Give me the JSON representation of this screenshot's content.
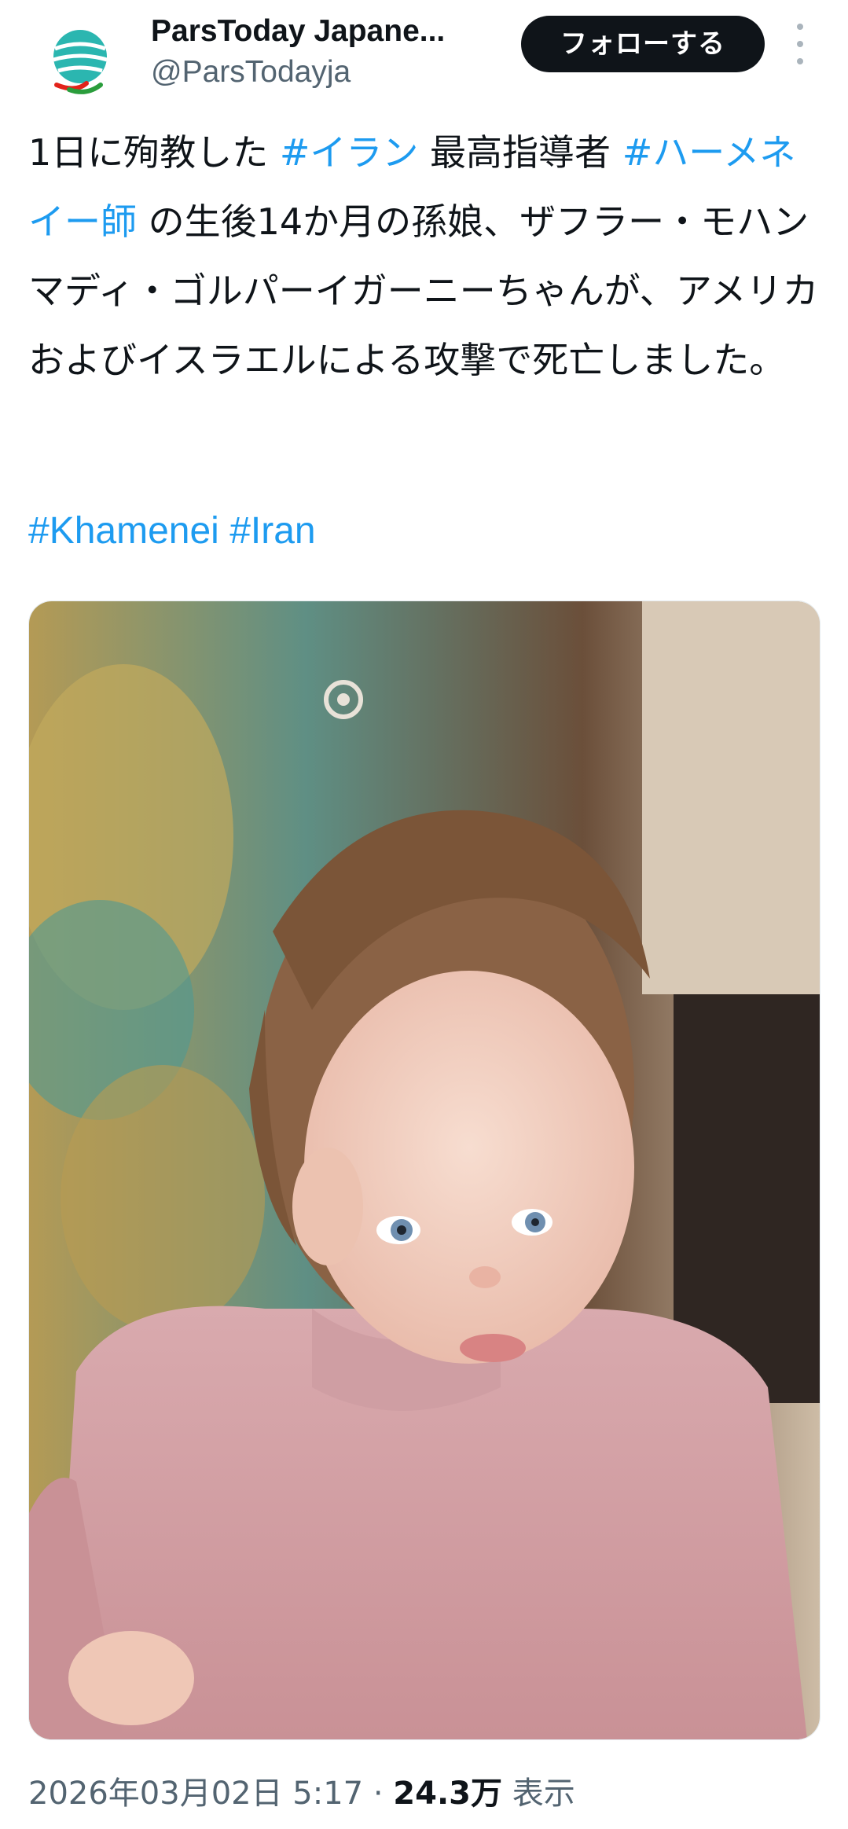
{
  "account": {
    "display_name": "ParsToday Japane...",
    "handle": "@ParsTodayja",
    "avatar_icon": "parstoday-logo-icon"
  },
  "follow_button": {
    "label": "フォローする"
  },
  "more_icon": "more-vertical-icon",
  "tweet": {
    "segments": [
      {
        "text": "1日に殉教した ",
        "link": false
      },
      {
        "text": "#イラン",
        "link": true
      },
      {
        "text": " 最高指導者 ",
        "link": false
      },
      {
        "text": "#ハーメネイー師",
        "link": true
      },
      {
        "text": " の生後14か月の孫娘、ザフラー・モハンマディ・ゴルパーイガーニーちゃんが、アメリカおよびイスラエルによる攻撃で死亡しました。",
        "link": false
      }
    ],
    "hashtags": [
      "#Khamenei",
      "#Iran"
    ]
  },
  "media": {
    "type": "photo",
    "alt": "",
    "colors": {
      "dress": "#d7a6ab",
      "hair": "#8a6245",
      "skin": "#f3d3c5",
      "cushion": "#b59a52"
    }
  },
  "meta": {
    "date_time": "2026年03月02日 5:17",
    "separator": "·",
    "views_count": "24.3万",
    "views_label": "表示"
  },
  "colors": {
    "link": "#1d9bf0",
    "text": "#0f1419",
    "secondary": "#536471",
    "button_bg": "#0f1419"
  }
}
